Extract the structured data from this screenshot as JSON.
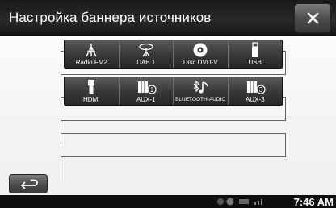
{
  "title": "Настройка баннера источников",
  "row1": [
    {
      "label": "Radio FM2",
      "icon": "antenna-icon"
    },
    {
      "label": "DAB 1",
      "icon": "dab-antenna-icon"
    },
    {
      "label": "Disc DVD-V",
      "icon": "disc-icon"
    },
    {
      "label": "USB",
      "icon": "usb-icon"
    }
  ],
  "row2": [
    {
      "label": "HDMI",
      "icon": "hdmi-icon"
    },
    {
      "label": "AUX-1",
      "icon": "aux-icon",
      "badge": "1"
    },
    {
      "label": "BLUETOOTH-AUDIO",
      "icon": "bluetooth-audio-icon"
    },
    {
      "label": "AUX-3",
      "icon": "aux-icon",
      "badge": "3"
    }
  ],
  "status": {
    "time": "7:46 AM"
  }
}
